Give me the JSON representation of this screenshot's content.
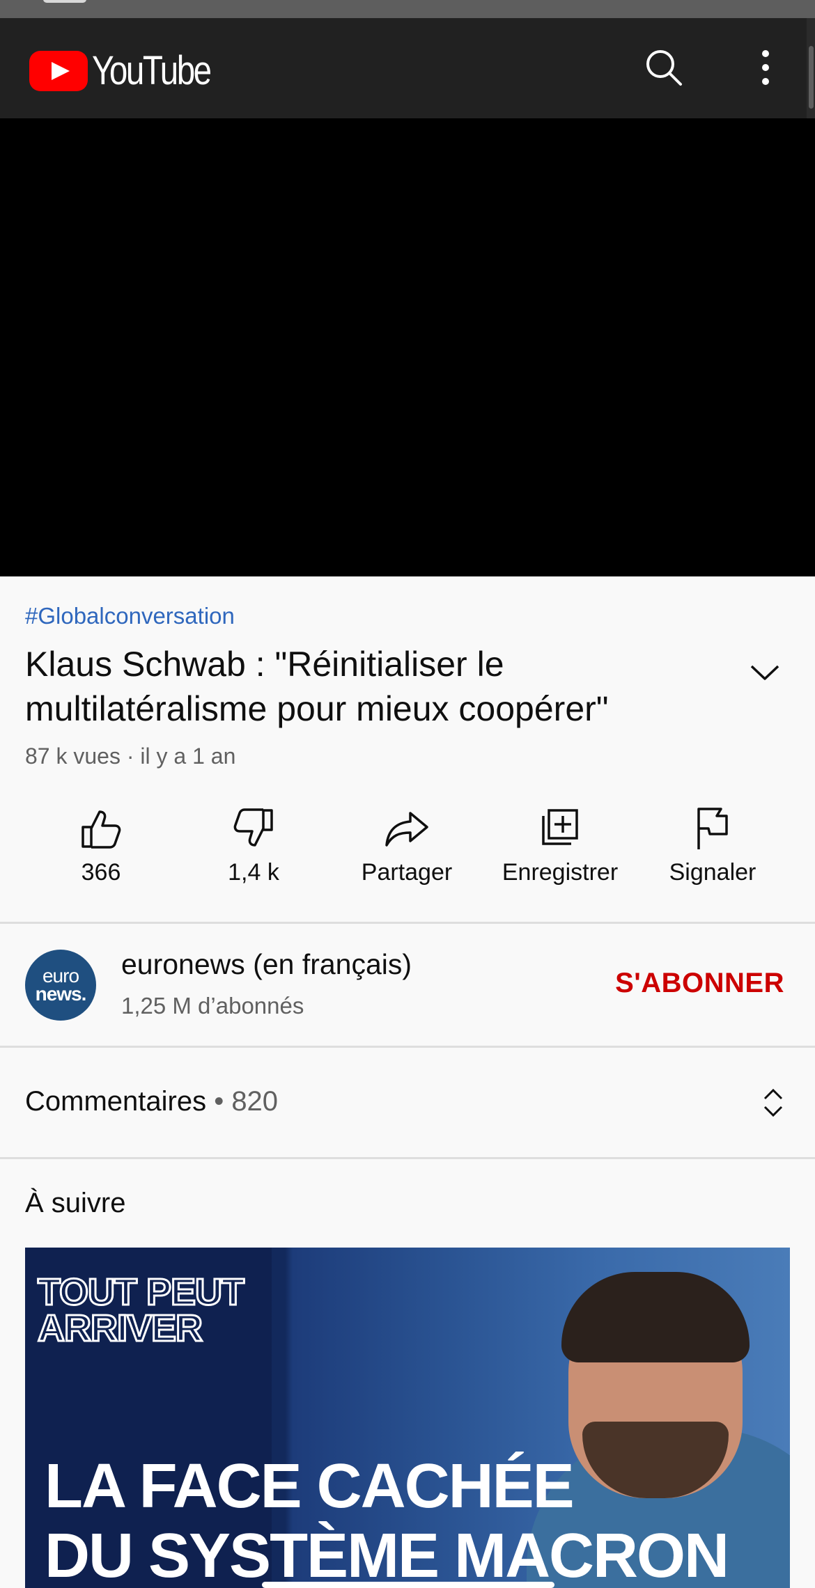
{
  "app": {
    "brand": "YouTube",
    "brand_color": "#ff0000"
  },
  "header": {
    "search_icon": "search-icon",
    "more_icon": "more-vert-icon"
  },
  "video": {
    "hashtag": "#Globalconversation",
    "title": "Klaus Schwab : \"Réinitialiser le multilatéralisme pour mieux coopérer\"",
    "meta": "87 k vues · il y a 1 an"
  },
  "actions": {
    "like": {
      "label": "366",
      "icon": "thumb-up-icon"
    },
    "dislike": {
      "label": "1,4 k",
      "icon": "thumb-down-icon"
    },
    "share": {
      "label": "Partager",
      "icon": "share-icon"
    },
    "save": {
      "label": "Enregistrer",
      "icon": "playlist-add-icon"
    },
    "report": {
      "label": "Signaler",
      "icon": "flag-icon"
    }
  },
  "channel": {
    "avatar_line1": "euro",
    "avatar_line2": "news.",
    "name": "euronews (en français)",
    "subscribers": "1,25 M d’abonnés",
    "subscribe_label": "S'ABONNER",
    "subscribe_color": "#cc0000"
  },
  "comments": {
    "label": "Commentaires",
    "separator": " • ",
    "count": "820"
  },
  "up_next": {
    "label": "À suivre",
    "thumbnail": {
      "badge": "TOUT PEUT\nARRIVER",
      "line1": "LA FACE CACHÉE",
      "line2": "DU SYSTÈME MACRON"
    }
  }
}
